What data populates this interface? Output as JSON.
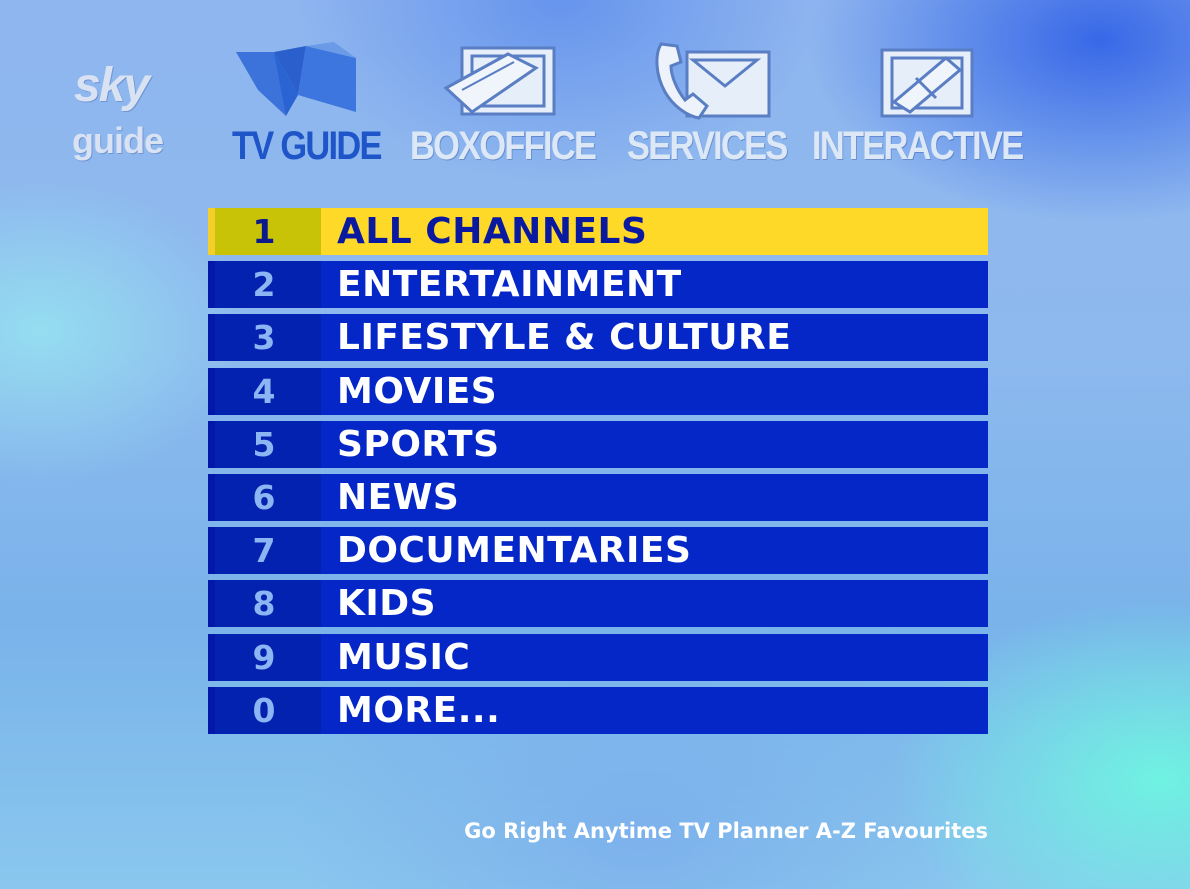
{
  "logo": {
    "line1": "sky",
    "line2": "guide"
  },
  "tabs": [
    {
      "label": "TV GUIDE",
      "icon": "tv-guide-icon",
      "active": true
    },
    {
      "label": "BOXOFFICE",
      "icon": "ticket-icon",
      "active": false
    },
    {
      "label": "SERVICES",
      "icon": "phone-letter-icon",
      "active": false
    },
    {
      "label": "INTERACTIVE",
      "icon": "interactive-icon",
      "active": false
    }
  ],
  "menu": {
    "selected_index": 0,
    "items": [
      {
        "number": "1",
        "label": "ALL CHANNELS"
      },
      {
        "number": "2",
        "label": "ENTERTAINMENT"
      },
      {
        "number": "3",
        "label": "LIFESTYLE & CULTURE"
      },
      {
        "number": "4",
        "label": "MOVIES"
      },
      {
        "number": "5",
        "label": "SPORTS"
      },
      {
        "number": "6",
        "label": "NEWS"
      },
      {
        "number": "7",
        "label": "DOCUMENTARIES"
      },
      {
        "number": "8",
        "label": "KIDS"
      },
      {
        "number": "9",
        "label": "MUSIC"
      },
      {
        "number": "0",
        "label": "MORE..."
      }
    ]
  },
  "footer": {
    "text": "Go Right Anytime TV Planner A-Z Favourites"
  },
  "colors": {
    "row_bg": "#0527c8",
    "number_bg": "#0422b0",
    "selected_bg": "#ffd928",
    "selected_number_bg": "#c9c307",
    "active_tab": "#1e55c8"
  }
}
